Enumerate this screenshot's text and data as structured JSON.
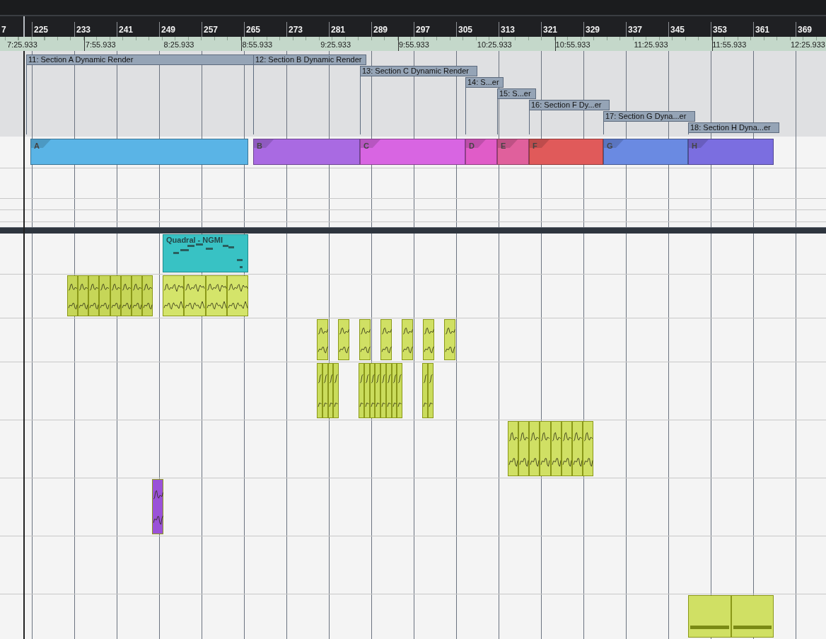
{
  "ruler": {
    "bars": [
      "7",
      "225",
      "233",
      "241",
      "249",
      "257",
      "265",
      "273",
      "281",
      "289",
      "297",
      "305",
      "313",
      "321",
      "329",
      "337",
      "345",
      "353",
      "361",
      "369"
    ],
    "times": [
      "7:25.933",
      "7:55.933",
      "8:25.933",
      "8:55.933",
      "9:25.933",
      "9:55.933",
      "10:25.933",
      "10:55.933",
      "11:25.933",
      "11:55.933",
      "12:25.933"
    ]
  },
  "cycle_markers": [
    {
      "label": "11: Section A Dynamic Render"
    },
    {
      "label": "12: Section B Dynamic Render"
    },
    {
      "label": "13: Section C Dynamic Render"
    },
    {
      "label": "14: S...er"
    },
    {
      "label": "15: S...er"
    },
    {
      "label": "16: Section F Dy...er"
    },
    {
      "label": "17: Section G Dyna...er"
    },
    {
      "label": "18: Section H Dyna...er"
    }
  ],
  "arranger": {
    "events": [
      {
        "label": "A",
        "color": "#5ab4e6"
      },
      {
        "label": "B",
        "color": "#a96ae2"
      },
      {
        "label": "C",
        "color": "#d865e2"
      },
      {
        "label": "D",
        "color": "#e05cc8"
      },
      {
        "label": "E",
        "color": "#e0609c"
      },
      {
        "label": "F",
        "color": "#e05a5a"
      },
      {
        "label": "G",
        "color": "#6a8ae2"
      },
      {
        "label": "H",
        "color": "#7b6ee0"
      }
    ]
  },
  "tracks": [
    {
      "clips": [
        {
          "kind": "midi",
          "name": "Quadral - NGMI",
          "color": "#38c2c4"
        }
      ]
    },
    {
      "clips": [
        {
          "kind": "audio",
          "color": "#c6d658"
        },
        {
          "kind": "audio",
          "color": "#d4e46a"
        }
      ]
    },
    {
      "clips": [
        {
          "kind": "audio",
          "color": "#d0e064"
        },
        {
          "kind": "audio",
          "color": "#d0e064"
        },
        {
          "kind": "audio",
          "color": "#d0e064"
        },
        {
          "kind": "audio",
          "color": "#d0e064"
        },
        {
          "kind": "audio",
          "color": "#d0e064"
        },
        {
          "kind": "audio",
          "color": "#d0e064"
        },
        {
          "kind": "audio",
          "color": "#d0e064"
        }
      ]
    },
    {
      "clips": [
        {
          "kind": "audio",
          "color": "#cadc5c"
        },
        {
          "kind": "audio",
          "color": "#cadc5c"
        },
        {
          "kind": "audio",
          "color": "#cadc5c"
        }
      ]
    },
    {
      "clips": [
        {
          "kind": "audio",
          "color": "#d0e064"
        }
      ]
    },
    {
      "clips": [
        {
          "kind": "audio",
          "color": "#9a52d8"
        }
      ]
    },
    {
      "clips": [
        {
          "kind": "audio",
          "color": "#d0e064"
        }
      ]
    }
  ]
}
